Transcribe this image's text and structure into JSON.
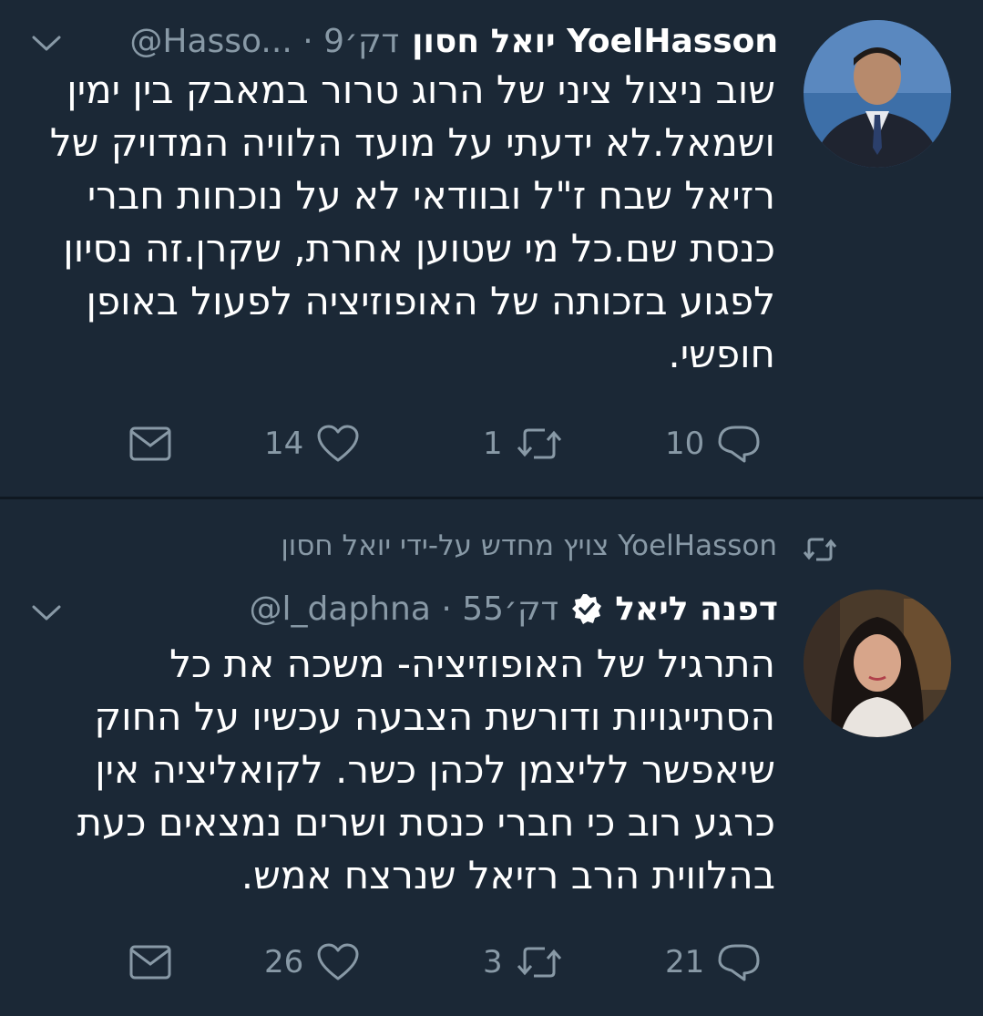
{
  "tweets": [
    {
      "name": "יואל חסון YoelHasson",
      "handle": "@Hasso... · 9דק׳",
      "text": "שוב ניצול ציני של הרוג טרור במאבק בין ימין ושמאל.לא ידעתי על מועד הלוויה המדויק של רזיאל שבח ז\"ל ובוודאי לא על נוכחות חברי כנסת שם.כל מי שטוען אחרת, שקרן.זה נסיון לפגוע בזכותה של האופוזיציה לפעול באופן חופשי.",
      "replies": "10",
      "retweets": "1",
      "likes": "14"
    },
    {
      "retweeted_by": "צויץ מחדש על-ידי יואל חסון YoelHasson",
      "name": "דפנה ליאל",
      "handle": "@l_daphna · 55דק׳",
      "text": "התרגיל של האופוזיציה- משכה את כל הסתייגויות ודורשת הצבעה עכשיו על החוק שיאפשר לליצמן לכהן כשר. לקואליציה אין כרגע רוב כי חברי כנסת ושרים נמצאים כעת בהלווית הרב רזיאל שנרצח אמש.",
      "replies": "21",
      "retweets": "3",
      "likes": "26"
    }
  ],
  "colors": {
    "background": "#1b2836",
    "divider": "#0f1821",
    "secondary_text": "#8899a6",
    "primary_text": "#ffffff"
  },
  "icons": [
    "chevron-down-icon",
    "verified-badge-icon",
    "reply-icon",
    "retweet-icon",
    "like-icon",
    "direct-message-icon"
  ]
}
